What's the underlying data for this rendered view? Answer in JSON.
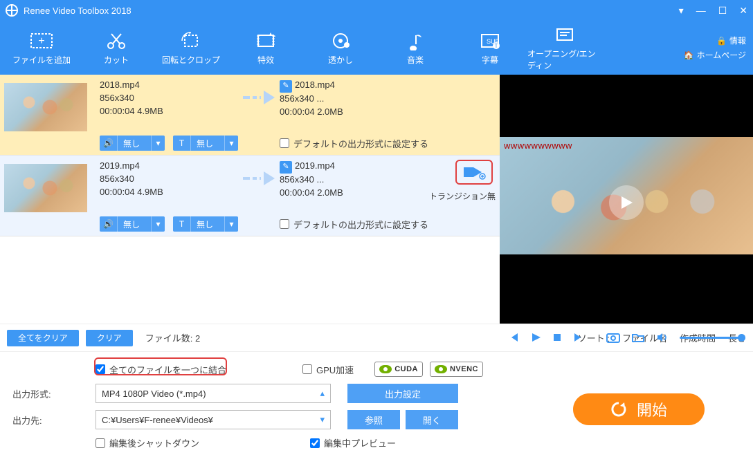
{
  "title": "Renee Video Toolbox 2018",
  "toolbar": {
    "add": "ファイルを追加",
    "cut": "カット",
    "rotate": "回転とクロップ",
    "effect": "特效",
    "watermark": "透かし",
    "music": "音楽",
    "subtitle": "字幕",
    "opening": "オープニング/エンディン"
  },
  "links": {
    "info": "情報",
    "home": "ホームページ"
  },
  "files": [
    {
      "in": {
        "name": "2018.mp4",
        "res": "856x340",
        "meta": "00:00:04  4.9MB"
      },
      "out": {
        "name": "2018.mp4",
        "res": "856x340      ...",
        "meta": "00:00:04  2.0MB"
      },
      "audio": "無し",
      "sub": "無し",
      "defaultLabel": "デフォルトの出力形式に設定する"
    },
    {
      "in": {
        "name": "2019.mp4",
        "res": "856x340",
        "meta": "00:00:04  4.9MB"
      },
      "out": {
        "name": "2019.mp4",
        "res": "856x340      ...",
        "meta": "00:00:04  2.0MB"
      },
      "audio": "無し",
      "sub": "無し",
      "defaultLabel": "デフォルトの出力形式に設定する",
      "transitionLabel": "トランジション無"
    }
  ],
  "listbar": {
    "clearAll": "全てをクリア",
    "clear": "クリア",
    "filecountLabel": "ファイル数:",
    "filecount": "2",
    "sortLabel": "ソート :",
    "sortName": "ファイル名",
    "sortTime": "作成時間",
    "sortLen": "長さ"
  },
  "preview": {
    "watermark": "wwwwwwwwww"
  },
  "bottom": {
    "merge": "全てのファイルを一つに結合",
    "gpu": "GPU加速",
    "cuda": "CUDA",
    "nvenc": "NVENC",
    "outFormatLabel": "出力形式:",
    "outFormatValue": "MP4 1080P Video (*.mp4)",
    "outSettings": "出力設定",
    "outDirLabel": "出力先:",
    "outDirValue": "C:¥Users¥F-renee¥Videos¥",
    "browse": "参照",
    "open": "開く",
    "shutdown": "編集後シャットダウン",
    "preview": "編集中プレビュー",
    "start": "開始"
  }
}
